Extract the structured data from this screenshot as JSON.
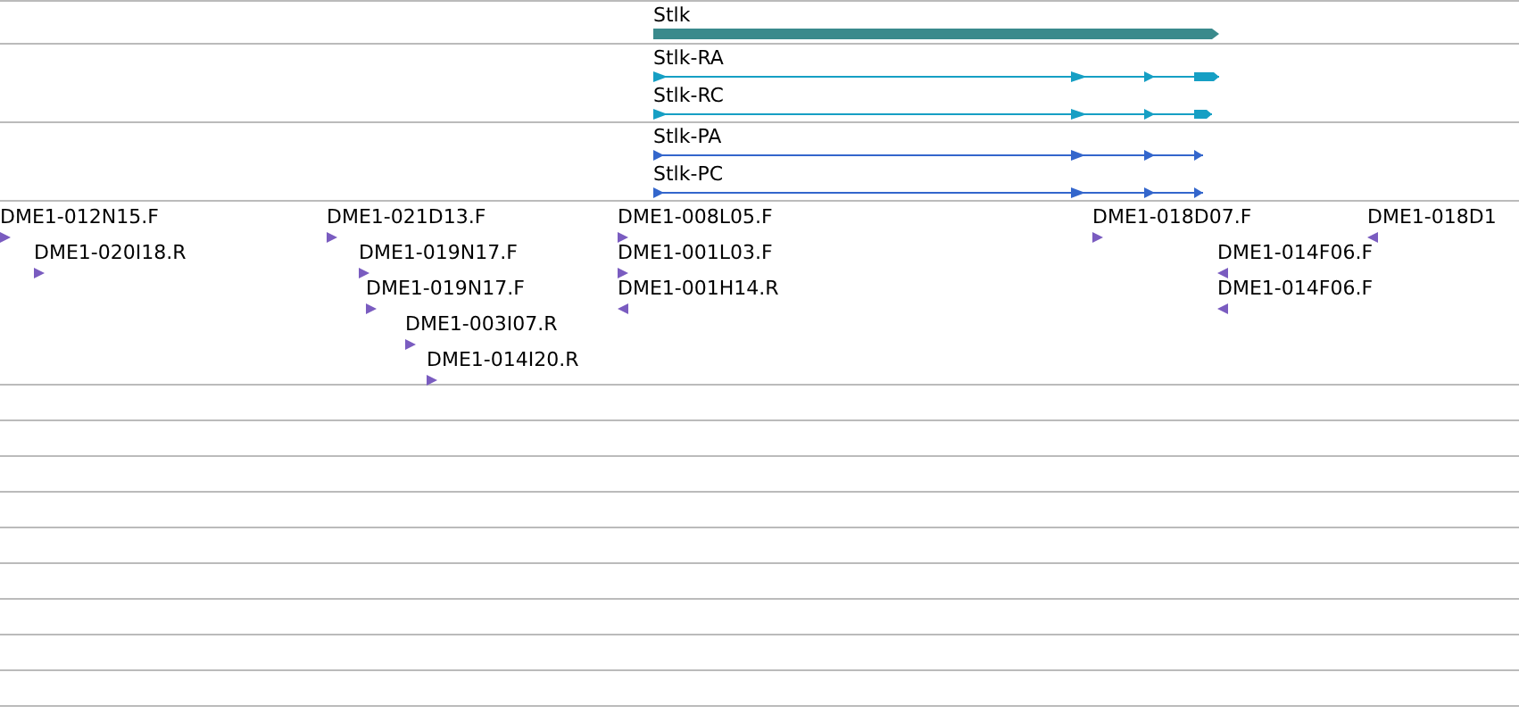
{
  "gene_track": {
    "genes": [
      {
        "name": "Stlk"
      }
    ]
  },
  "transcript_track": {
    "transcripts": [
      {
        "name": "Stlk-RA"
      },
      {
        "name": "Stlk-RC"
      }
    ]
  },
  "protein_track": {
    "proteins": [
      {
        "name": "Stlk-PA"
      },
      {
        "name": "Stlk-PC"
      }
    ]
  },
  "clone_track": {
    "clones": [
      {
        "name": "DME1-012N15.F",
        "kind": "forward"
      },
      {
        "name": "DME1-020I18.R",
        "kind": "forward"
      },
      {
        "name": "DME1-021D13.F",
        "kind": "forward"
      },
      {
        "name": "DME1-019N17.F",
        "kind": "forward"
      },
      {
        "name": "DME1-019N17.F",
        "kind": "forward"
      },
      {
        "name": "DME1-003I07.R",
        "kind": "forward"
      },
      {
        "name": "DME1-014I20.R",
        "kind": "forward"
      },
      {
        "name": "DME1-008L05.F",
        "kind": "forward"
      },
      {
        "name": "DME1-001L03.F",
        "kind": "forward"
      },
      {
        "name": "DME1-001H14.R",
        "kind": "reverse"
      },
      {
        "name": "DME1-018D07.F",
        "kind": "forward"
      },
      {
        "name": "DME1-014F06.F",
        "kind": "reverse"
      },
      {
        "name": "DME1-014F06.F",
        "kind": "reverse"
      },
      {
        "name": "DME1-018D1",
        "kind": "reverse"
      }
    ]
  }
}
